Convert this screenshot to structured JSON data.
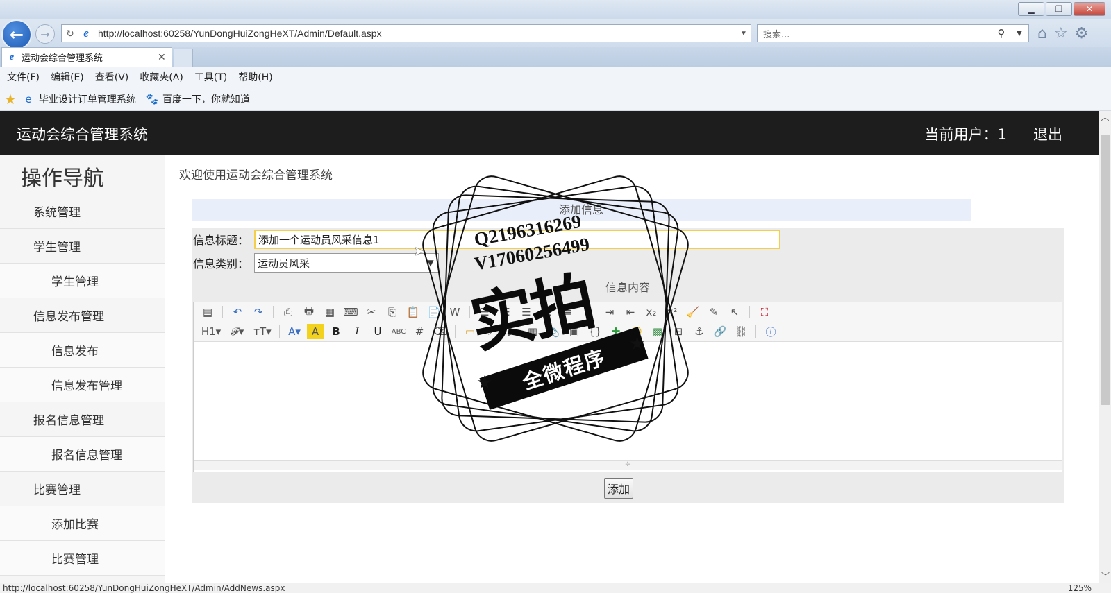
{
  "browser": {
    "url": "http://localhost:60258/YunDongHuiZongHeXT/Admin/Default.aspx",
    "search_placeholder": "搜索...",
    "tab_title": "运动会综合管理系统",
    "menu": [
      "文件(F)",
      "编辑(E)",
      "查看(V)",
      "收藏夹(A)",
      "工具(T)",
      "帮助(H)"
    ],
    "favorites": [
      "毕业设计订单管理系统",
      "百度一下，你就知道"
    ],
    "status_url": "http://localhost:60258/YunDongHuiZongHeXT/Admin/AddNews.aspx",
    "zoom": "125%"
  },
  "header": {
    "title": "运动会综合管理系统",
    "user": "当前用户：1",
    "logout": "退出"
  },
  "sidebar": {
    "title": "操作导航",
    "items": [
      {
        "label": "系统管理",
        "level": 1
      },
      {
        "label": "学生管理",
        "level": 1
      },
      {
        "label": "学生管理",
        "level": 2
      },
      {
        "label": "信息发布管理",
        "level": 1
      },
      {
        "label": "信息发布",
        "level": 2
      },
      {
        "label": "信息发布管理",
        "level": 2
      },
      {
        "label": "报名信息管理",
        "level": 1
      },
      {
        "label": "报名信息管理",
        "level": 2
      },
      {
        "label": "比赛管理",
        "level": 1
      },
      {
        "label": "添加比赛",
        "level": 2
      },
      {
        "label": "比赛管理",
        "level": 2
      }
    ]
  },
  "main": {
    "welcome": "欢迎使用运动会综合管理系统",
    "panel_title": "添加信息",
    "title_label": "信息标题：",
    "title_value": "添加一个运动员风采信息1",
    "category_label": "信息类别：",
    "category_value": "运动员风采",
    "content_label": "信息内容",
    "submit": "添加"
  },
  "watermark": {
    "qq": "Q2196316269",
    "wechat": "V17060256499",
    "big": "实拍",
    "ribbon": "全微程序"
  }
}
